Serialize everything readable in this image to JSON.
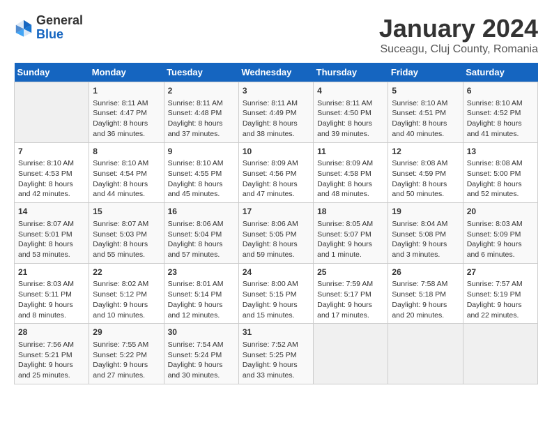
{
  "logo": {
    "general": "General",
    "blue": "Blue"
  },
  "title": "January 2024",
  "subtitle": "Suceagu, Cluj County, Romania",
  "weekdays": [
    "Sunday",
    "Monday",
    "Tuesday",
    "Wednesday",
    "Thursday",
    "Friday",
    "Saturday"
  ],
  "weeks": [
    [
      {
        "day": "",
        "sunrise": "",
        "sunset": "",
        "daylight": ""
      },
      {
        "day": "1",
        "sunrise": "Sunrise: 8:11 AM",
        "sunset": "Sunset: 4:47 PM",
        "daylight": "Daylight: 8 hours and 36 minutes."
      },
      {
        "day": "2",
        "sunrise": "Sunrise: 8:11 AM",
        "sunset": "Sunset: 4:48 PM",
        "daylight": "Daylight: 8 hours and 37 minutes."
      },
      {
        "day": "3",
        "sunrise": "Sunrise: 8:11 AM",
        "sunset": "Sunset: 4:49 PM",
        "daylight": "Daylight: 8 hours and 38 minutes."
      },
      {
        "day": "4",
        "sunrise": "Sunrise: 8:11 AM",
        "sunset": "Sunset: 4:50 PM",
        "daylight": "Daylight: 8 hours and 39 minutes."
      },
      {
        "day": "5",
        "sunrise": "Sunrise: 8:10 AM",
        "sunset": "Sunset: 4:51 PM",
        "daylight": "Daylight: 8 hours and 40 minutes."
      },
      {
        "day": "6",
        "sunrise": "Sunrise: 8:10 AM",
        "sunset": "Sunset: 4:52 PM",
        "daylight": "Daylight: 8 hours and 41 minutes."
      }
    ],
    [
      {
        "day": "7",
        "sunrise": "Sunrise: 8:10 AM",
        "sunset": "Sunset: 4:53 PM",
        "daylight": "Daylight: 8 hours and 42 minutes."
      },
      {
        "day": "8",
        "sunrise": "Sunrise: 8:10 AM",
        "sunset": "Sunset: 4:54 PM",
        "daylight": "Daylight: 8 hours and 44 minutes."
      },
      {
        "day": "9",
        "sunrise": "Sunrise: 8:10 AM",
        "sunset": "Sunset: 4:55 PM",
        "daylight": "Daylight: 8 hours and 45 minutes."
      },
      {
        "day": "10",
        "sunrise": "Sunrise: 8:09 AM",
        "sunset": "Sunset: 4:56 PM",
        "daylight": "Daylight: 8 hours and 47 minutes."
      },
      {
        "day": "11",
        "sunrise": "Sunrise: 8:09 AM",
        "sunset": "Sunset: 4:58 PM",
        "daylight": "Daylight: 8 hours and 48 minutes."
      },
      {
        "day": "12",
        "sunrise": "Sunrise: 8:08 AM",
        "sunset": "Sunset: 4:59 PM",
        "daylight": "Daylight: 8 hours and 50 minutes."
      },
      {
        "day": "13",
        "sunrise": "Sunrise: 8:08 AM",
        "sunset": "Sunset: 5:00 PM",
        "daylight": "Daylight: 8 hours and 52 minutes."
      }
    ],
    [
      {
        "day": "14",
        "sunrise": "Sunrise: 8:07 AM",
        "sunset": "Sunset: 5:01 PM",
        "daylight": "Daylight: 8 hours and 53 minutes."
      },
      {
        "day": "15",
        "sunrise": "Sunrise: 8:07 AM",
        "sunset": "Sunset: 5:03 PM",
        "daylight": "Daylight: 8 hours and 55 minutes."
      },
      {
        "day": "16",
        "sunrise": "Sunrise: 8:06 AM",
        "sunset": "Sunset: 5:04 PM",
        "daylight": "Daylight: 8 hours and 57 minutes."
      },
      {
        "day": "17",
        "sunrise": "Sunrise: 8:06 AM",
        "sunset": "Sunset: 5:05 PM",
        "daylight": "Daylight: 8 hours and 59 minutes."
      },
      {
        "day": "18",
        "sunrise": "Sunrise: 8:05 AM",
        "sunset": "Sunset: 5:07 PM",
        "daylight": "Daylight: 9 hours and 1 minute."
      },
      {
        "day": "19",
        "sunrise": "Sunrise: 8:04 AM",
        "sunset": "Sunset: 5:08 PM",
        "daylight": "Daylight: 9 hours and 3 minutes."
      },
      {
        "day": "20",
        "sunrise": "Sunrise: 8:03 AM",
        "sunset": "Sunset: 5:09 PM",
        "daylight": "Daylight: 9 hours and 6 minutes."
      }
    ],
    [
      {
        "day": "21",
        "sunrise": "Sunrise: 8:03 AM",
        "sunset": "Sunset: 5:11 PM",
        "daylight": "Daylight: 9 hours and 8 minutes."
      },
      {
        "day": "22",
        "sunrise": "Sunrise: 8:02 AM",
        "sunset": "Sunset: 5:12 PM",
        "daylight": "Daylight: 9 hours and 10 minutes."
      },
      {
        "day": "23",
        "sunrise": "Sunrise: 8:01 AM",
        "sunset": "Sunset: 5:14 PM",
        "daylight": "Daylight: 9 hours and 12 minutes."
      },
      {
        "day": "24",
        "sunrise": "Sunrise: 8:00 AM",
        "sunset": "Sunset: 5:15 PM",
        "daylight": "Daylight: 9 hours and 15 minutes."
      },
      {
        "day": "25",
        "sunrise": "Sunrise: 7:59 AM",
        "sunset": "Sunset: 5:17 PM",
        "daylight": "Daylight: 9 hours and 17 minutes."
      },
      {
        "day": "26",
        "sunrise": "Sunrise: 7:58 AM",
        "sunset": "Sunset: 5:18 PM",
        "daylight": "Daylight: 9 hours and 20 minutes."
      },
      {
        "day": "27",
        "sunrise": "Sunrise: 7:57 AM",
        "sunset": "Sunset: 5:19 PM",
        "daylight": "Daylight: 9 hours and 22 minutes."
      }
    ],
    [
      {
        "day": "28",
        "sunrise": "Sunrise: 7:56 AM",
        "sunset": "Sunset: 5:21 PM",
        "daylight": "Daylight: 9 hours and 25 minutes."
      },
      {
        "day": "29",
        "sunrise": "Sunrise: 7:55 AM",
        "sunset": "Sunset: 5:22 PM",
        "daylight": "Daylight: 9 hours and 27 minutes."
      },
      {
        "day": "30",
        "sunrise": "Sunrise: 7:54 AM",
        "sunset": "Sunset: 5:24 PM",
        "daylight": "Daylight: 9 hours and 30 minutes."
      },
      {
        "day": "31",
        "sunrise": "Sunrise: 7:52 AM",
        "sunset": "Sunset: 5:25 PM",
        "daylight": "Daylight: 9 hours and 33 minutes."
      },
      {
        "day": "",
        "sunrise": "",
        "sunset": "",
        "daylight": ""
      },
      {
        "day": "",
        "sunrise": "",
        "sunset": "",
        "daylight": ""
      },
      {
        "day": "",
        "sunrise": "",
        "sunset": "",
        "daylight": ""
      }
    ]
  ]
}
